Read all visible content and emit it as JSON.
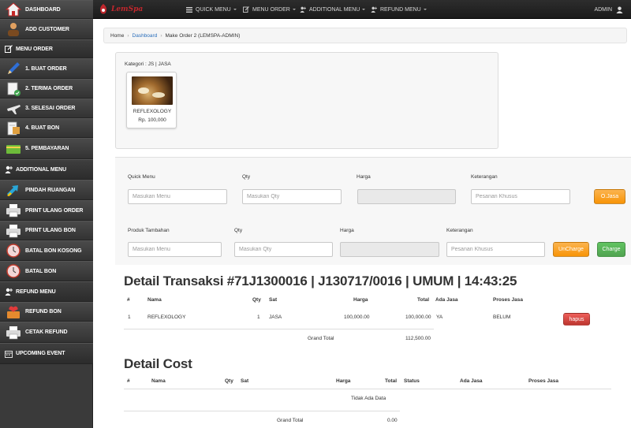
{
  "sidebar": {
    "items": [
      {
        "label": "DASHBOARD",
        "icon": "home-icon"
      },
      {
        "label": "ADD CUSTOMER",
        "icon": "customer-icon"
      },
      {
        "label": "MENU ORDER",
        "icon": "edit-icon"
      },
      {
        "label": "1. BUAT ORDER",
        "icon": "pencil-icon"
      },
      {
        "label": "2. TERIMA ORDER",
        "icon": "document-check-icon"
      },
      {
        "label": "3. SELESAI ORDER",
        "icon": "plane-icon"
      },
      {
        "label": "4. BUAT BON",
        "icon": "receipt-icon"
      },
      {
        "label": "5. PEMBAYARAN",
        "icon": "card-icon"
      },
      {
        "label": "ADDITIONAL MENU",
        "icon": "user-plus-icon"
      },
      {
        "label": "PINDAH RUANGAN",
        "icon": "transfer-icon"
      },
      {
        "label": "PRINT ULANG ORDER",
        "icon": "printer-icon"
      },
      {
        "label": "PRINT ULANG BON",
        "icon": "printer-icon"
      },
      {
        "label": "BATAL BON KOSONG",
        "icon": "clock-icon"
      },
      {
        "label": "BATAL BON",
        "icon": "clock-icon"
      },
      {
        "label": "REFUND MENU",
        "icon": "user-plus-icon"
      },
      {
        "label": "REFUND BON",
        "icon": "heart-icon"
      },
      {
        "label": "CETAK REFUND",
        "icon": "printer-icon"
      },
      {
        "label": "UPCOMING EVENT",
        "icon": "calendar-icon"
      }
    ]
  },
  "topbar": {
    "logo_text": "LemSpa",
    "menus": [
      "QUICK MENU",
      "MENU ORDER",
      "ADDITIONAL MENU",
      "REFUND MENU"
    ],
    "user": "ADMIN"
  },
  "breadcrumb": {
    "home": "Home",
    "dashboard": "Dashboard",
    "current": "Make Order 2 (LEMSPA-ADMIN)"
  },
  "category": {
    "title": "Kategori : JS | JASA",
    "products": [
      {
        "name": "REFLEXOLOGY",
        "price": "Rp. 100,000"
      }
    ]
  },
  "form": {
    "row1": {
      "labels": {
        "menu": "Quick Menu",
        "qty": "Qty",
        "harga": "Harga",
        "ket": "Keterangan"
      },
      "placeholders": {
        "menu": "Masukan Menu",
        "qty": "Masukan Qty",
        "ket": "Pesanan Khusus"
      },
      "button": "O.Jasa"
    },
    "row2": {
      "labels": {
        "produk": "Produk Tambahan",
        "qty": "Qty",
        "harga": "Harga",
        "ket": "Keterangan"
      },
      "placeholders": {
        "produk": "Masukan Menu",
        "qty": "Masukan Qty",
        "ket": "Pesanan Khusus"
      },
      "uncharge": "UnCharge",
      "charge": "Charge"
    }
  },
  "detail_transaksi": {
    "title": "Detail Transaksi #71J1300016 | J130717/0016 | UMUM | 14:43:25",
    "headers": {
      "no": "#",
      "nama": "Nama",
      "qty": "Qty",
      "sat": "Sat",
      "harga": "Harga",
      "total": "Total",
      "ada_jasa": "Ada Jasa",
      "proses_jasa": "Proses Jasa"
    },
    "rows": [
      {
        "no": "1",
        "nama": "REFLEXOLOGY",
        "qty": "1",
        "sat": "JASA",
        "harga": "100,000.00",
        "total": "100,000.00",
        "ada_jasa": "YA",
        "proses_jasa": "BELUM",
        "action": "hapus"
      }
    ],
    "grand_total_label": "Grand Total",
    "grand_total_value": "112,500.00"
  },
  "detail_cost": {
    "title": "Detail Cost",
    "headers": {
      "no": "#",
      "nama": "Nama",
      "qty": "Qty",
      "sat": "Sat",
      "harga": "Harga",
      "total": "Total",
      "status": "Status",
      "ada_jasa": "Ada Jasa",
      "proses_jasa": "Proses Jasa"
    },
    "empty_text": "Tidak Ada Data",
    "grand_total_label": "Grand Total",
    "grand_total_value": "0.00"
  }
}
